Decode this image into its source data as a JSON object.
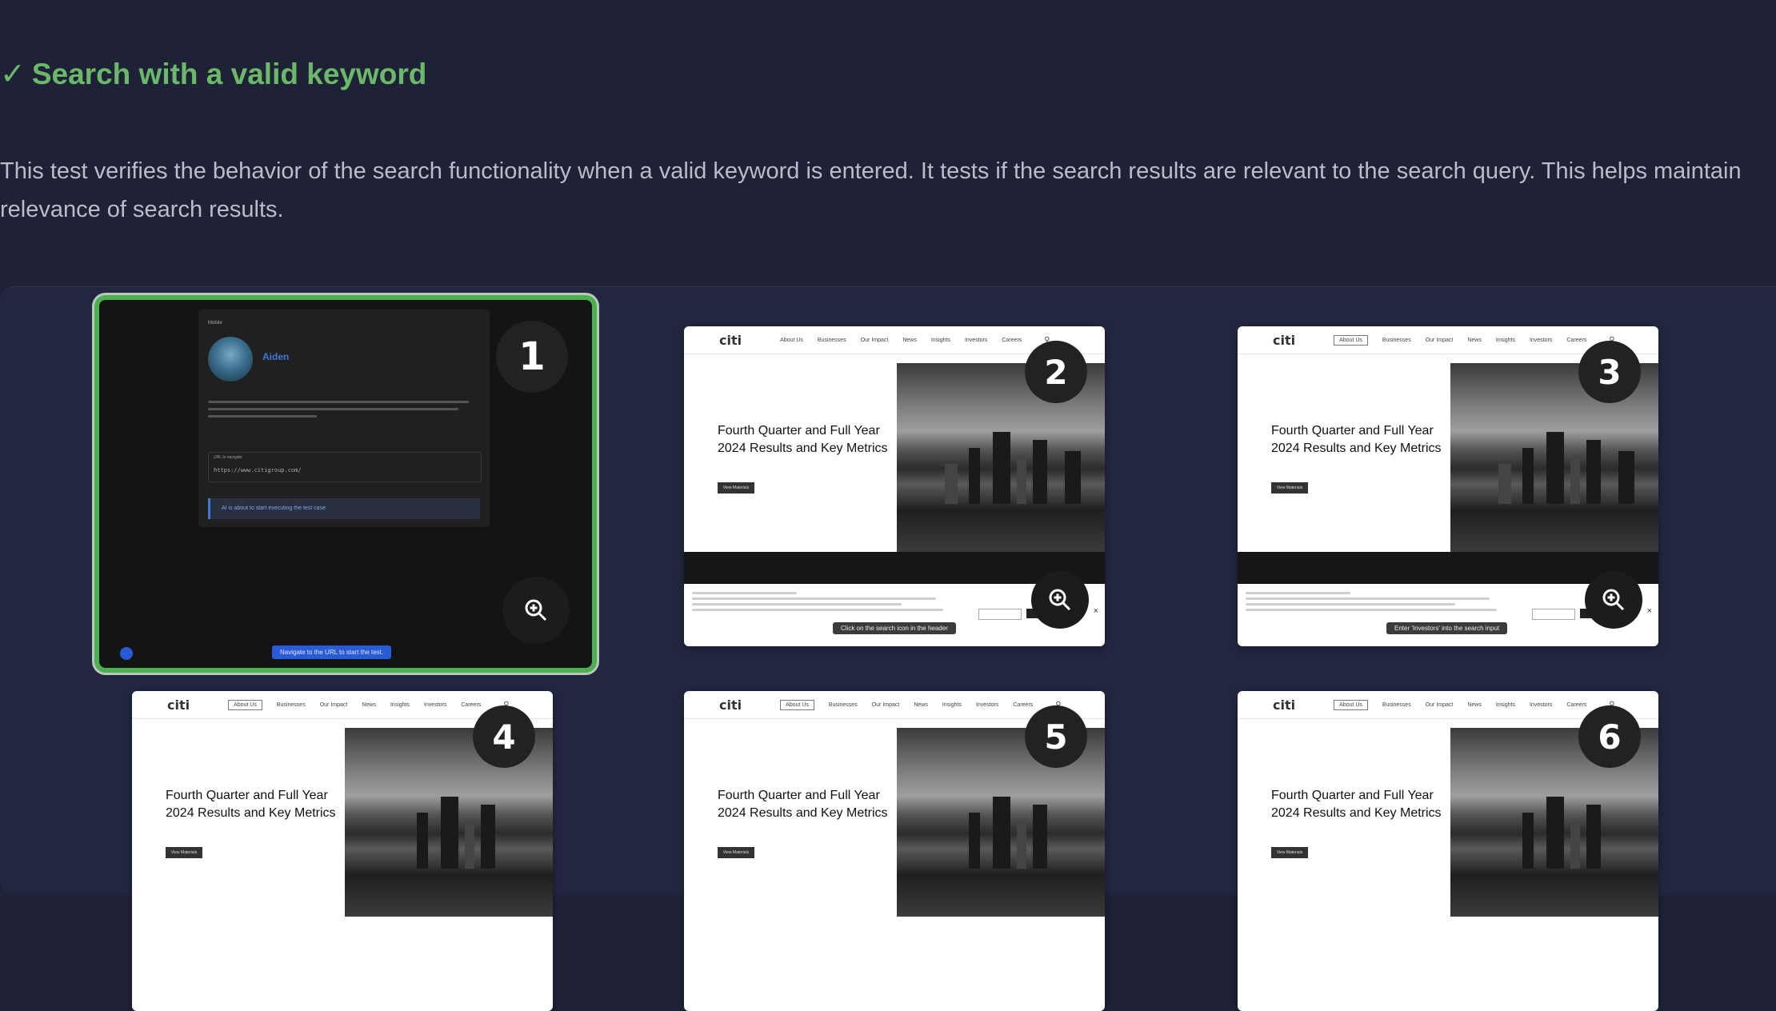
{
  "heading": {
    "check_icon": "✓",
    "title": "Search with a valid keyword"
  },
  "description": "This test verifies the behavior of the search functionality when a valid keyword is entered. It tests if the search results are relevant to the search query. This helps maintain relevance of search results.",
  "colors": {
    "background": "#1f2136",
    "panel": "#222640",
    "title_green": "#6cb86a",
    "selected_border": "#4caf50"
  },
  "step1": {
    "number": "1",
    "user_name": "Aiden",
    "brand_label": "Mobile",
    "url_label": "URL to navigate",
    "url_value": "https://www.citigroup.com/",
    "status_text": "AI is about to start executing the test case",
    "footer_action": "Navigate to the URL to start the test.",
    "zoom_icon": "zoom-in-icon"
  },
  "citi_page": {
    "logo": "citi",
    "nav": [
      "About Us",
      "Businesses",
      "Our Impact",
      "News",
      "Insights",
      "Investors",
      "Careers"
    ],
    "hero_title": "Fourth Quarter and Full Year 2024 Results and Key Metrics",
    "hero_button": "View Materials"
  },
  "steps": [
    {
      "number": "2",
      "tooltip": "Click on the search icon in the header"
    },
    {
      "number": "3",
      "tooltip": "Enter 'Investors' into the search input"
    },
    {
      "number": "4",
      "tooltip": ""
    },
    {
      "number": "5",
      "tooltip": ""
    },
    {
      "number": "6",
      "tooltip": ""
    }
  ]
}
